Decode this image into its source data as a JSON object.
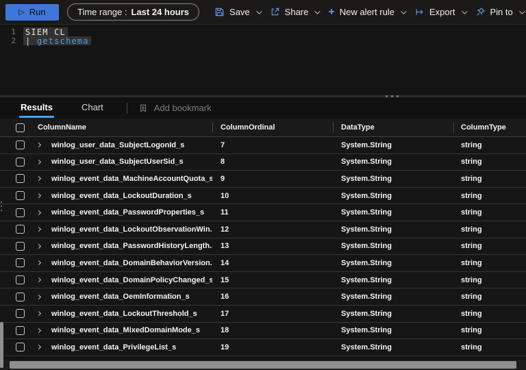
{
  "toolbar": {
    "run_label": "Run",
    "time_range": {
      "label": "Time range :",
      "value": "Last 24 hours"
    },
    "items": [
      {
        "label": "Save",
        "icon": "save-icon"
      },
      {
        "label": "Share",
        "icon": "share-icon"
      },
      {
        "label": "New alert rule",
        "icon": "plus-icon"
      },
      {
        "label": "Export",
        "icon": "export-icon"
      },
      {
        "label": "Pin to",
        "icon": "pin-icon"
      }
    ]
  },
  "editor": {
    "line1_number": "1",
    "line1_code": "SIEM_CL",
    "line2_number": "2",
    "line2_pipe": "| ",
    "line2_keyword": "getschema"
  },
  "results": {
    "tabs": [
      {
        "label": "Results",
        "active": true
      },
      {
        "label": "Chart",
        "active": false
      }
    ],
    "add_bookmark_label": "Add bookmark",
    "table": {
      "columns": [
        "ColumnName",
        "ColumnOrdinal",
        "DataType",
        "ColumnType"
      ],
      "rows": [
        [
          "winlog_user_data_SubjectLogonId_s",
          "7",
          "System.String",
          "string"
        ],
        [
          "winlog_user_data_SubjectUserSid_s",
          "8",
          "System.String",
          "string"
        ],
        [
          "winlog_event_data_MachineAccountQuota_s",
          "9",
          "System.String",
          "string"
        ],
        [
          "winlog_event_data_LockoutDuration_s",
          "10",
          "System.String",
          "string"
        ],
        [
          "winlog_event_data_PasswordProperties_s",
          "11",
          "System.String",
          "string"
        ],
        [
          "winlog_event_data_LockoutObservationWin...",
          "12",
          "System.String",
          "string"
        ],
        [
          "winlog_event_data_PasswordHistoryLength...",
          "13",
          "System.String",
          "string"
        ],
        [
          "winlog_event_data_DomainBehaviorVersion...",
          "14",
          "System.String",
          "string"
        ],
        [
          "winlog_event_data_DomainPolicyChanged_s",
          "15",
          "System.String",
          "string"
        ],
        [
          "winlog_event_data_OemInformation_s",
          "16",
          "System.String",
          "string"
        ],
        [
          "winlog_event_data_LockoutThreshold_s",
          "17",
          "System.String",
          "string"
        ],
        [
          "winlog_event_data_MixedDomainMode_s",
          "18",
          "System.String",
          "string"
        ],
        [
          "winlog_event_data_PrivilegeList_s",
          "19",
          "System.String",
          "string"
        ]
      ]
    }
  },
  "colors": {
    "run_button": "#3e77d8",
    "accent_blue": "#5d98e8",
    "tab_underline": "#47a3f3",
    "keyword_blue": "#569cd6",
    "scrollbar_thumb": "#8f8f8f"
  }
}
